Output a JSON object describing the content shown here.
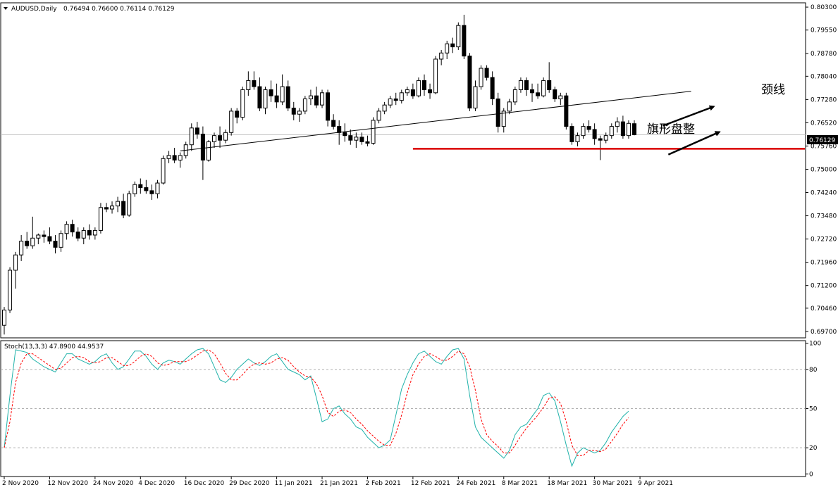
{
  "symbol_header": "AUDUSD,Daily",
  "ohlc_header": "0.76494 0.76600 0.76114 0.76129",
  "stoch_header": "Stoch(13,3,3) 47.8900 44.9537",
  "annotations": {
    "neckline_label": "颈线",
    "flag_label": "旗形盘整"
  },
  "colors": {
    "candle_outline": "#000000",
    "up_fill": "#ffffff",
    "down_fill": "#000000",
    "support_line": "#d90000",
    "stoch_main": "#20b2aa",
    "stoch_signal": "#ff0000",
    "price_marker_bg": "#000000"
  },
  "chart_data": [
    {
      "type": "candlestick",
      "title": "AUDUSD,Daily",
      "ylim": [
        0.6949,
        0.8044
      ],
      "price_ticks": [
        "0.80300",
        "0.79550",
        "0.78780",
        "0.78040",
        "0.77280",
        "0.76520",
        "0.75760",
        "0.75000",
        "0.74240",
        "0.73480",
        "0.72720",
        "0.71960",
        "0.71200",
        "0.70460",
        "0.69700"
      ],
      "current_price": "0.76129",
      "x_labels": [
        "2 Nov 2020",
        "12 Nov 2020",
        "24 Nov 2020",
        "4 Dec 2020",
        "16 Dec 2020",
        "29 Dec 2020",
        "11 Jan 2021",
        "21 Jan 2021",
        "2 Feb 2021",
        "12 Feb 2021",
        "24 Feb 2021",
        "8 Mar 2021",
        "18 Mar 2021",
        "30 Mar 2021",
        "9 Apr 2021"
      ],
      "support_level": 0.7567,
      "neckline": {
        "start": [
          31,
          0.756
        ],
        "end": [
          121,
          0.7755
        ]
      },
      "flag_arrows": [
        {
          "start": [
            116,
            0.7642
          ],
          "end": [
            125,
            0.7705
          ]
        },
        {
          "start": [
            117,
            0.7548
          ],
          "end": [
            126,
            0.7622
          ]
        }
      ],
      "ohlc": [
        [
          0.699,
          0.705,
          0.696,
          0.704
        ],
        [
          0.704,
          0.718,
          0.703,
          0.717
        ],
        [
          0.717,
          0.723,
          0.711,
          0.722
        ],
        [
          0.722,
          0.7285,
          0.72,
          0.7265
        ],
        [
          0.7265,
          0.7295,
          0.724,
          0.725
        ],
        [
          0.725,
          0.7345,
          0.724,
          0.7275
        ],
        [
          0.7275,
          0.729,
          0.7255,
          0.7285
        ],
        [
          0.7285,
          0.73,
          0.726,
          0.728
        ],
        [
          0.728,
          0.731,
          0.7255,
          0.7265
        ],
        [
          0.7265,
          0.7285,
          0.7225,
          0.7245
        ],
        [
          0.7245,
          0.73,
          0.723,
          0.729
        ],
        [
          0.729,
          0.733,
          0.727,
          0.732
        ],
        [
          0.732,
          0.7335,
          0.728,
          0.7295
        ],
        [
          0.7295,
          0.731,
          0.7265,
          0.7275
        ],
        [
          0.7275,
          0.731,
          0.7255,
          0.73
        ],
        [
          0.73,
          0.732,
          0.727,
          0.7285
        ],
        [
          0.7285,
          0.731,
          0.727,
          0.73
        ],
        [
          0.73,
          0.739,
          0.729,
          0.7375
        ],
        [
          0.7375,
          0.739,
          0.736,
          0.737
        ],
        [
          0.737,
          0.7395,
          0.7355,
          0.738
        ],
        [
          0.738,
          0.741,
          0.736,
          0.7395
        ],
        [
          0.7395,
          0.742,
          0.734,
          0.735
        ],
        [
          0.735,
          0.743,
          0.7345,
          0.742
        ],
        [
          0.742,
          0.746,
          0.741,
          0.745
        ],
        [
          0.745,
          0.747,
          0.742,
          0.744
        ],
        [
          0.744,
          0.7465,
          0.742,
          0.743
        ],
        [
          0.743,
          0.745,
          0.74,
          0.742
        ],
        [
          0.742,
          0.7465,
          0.7405,
          0.7455
        ],
        [
          0.7455,
          0.7545,
          0.745,
          0.7535
        ],
        [
          0.7535,
          0.756,
          0.752,
          0.7545
        ],
        [
          0.7545,
          0.757,
          0.752,
          0.753
        ],
        [
          0.753,
          0.7555,
          0.7505,
          0.7545
        ],
        [
          0.7545,
          0.759,
          0.7535,
          0.758
        ],
        [
          0.758,
          0.765,
          0.756,
          0.7635
        ],
        [
          0.7635,
          0.7655,
          0.76,
          0.7615
        ],
        [
          0.7615,
          0.764,
          0.7465,
          0.753
        ],
        [
          0.753,
          0.7595,
          0.7525,
          0.759
        ],
        [
          0.759,
          0.762,
          0.757,
          0.761
        ],
        [
          0.761,
          0.764,
          0.757,
          0.7595
        ],
        [
          0.7595,
          0.763,
          0.7585,
          0.762
        ],
        [
          0.762,
          0.77,
          0.761,
          0.769
        ],
        [
          0.769,
          0.77,
          0.765,
          0.767
        ],
        [
          0.767,
          0.777,
          0.766,
          0.776
        ],
        [
          0.776,
          0.782,
          0.774,
          0.779
        ],
        [
          0.779,
          0.782,
          0.776,
          0.777
        ],
        [
          0.777,
          0.78,
          0.769,
          0.77
        ],
        [
          0.77,
          0.777,
          0.768,
          0.776
        ],
        [
          0.776,
          0.779,
          0.772,
          0.774
        ],
        [
          0.774,
          0.778,
          0.77,
          0.772
        ],
        [
          0.772,
          0.781,
          0.771,
          0.777
        ],
        [
          0.777,
          0.779,
          0.769,
          0.77
        ],
        [
          0.77,
          0.772,
          0.766,
          0.768
        ],
        [
          0.768,
          0.77,
          0.7655,
          0.769
        ],
        [
          0.769,
          0.774,
          0.768,
          0.773
        ],
        [
          0.773,
          0.776,
          0.771,
          0.774
        ],
        [
          0.774,
          0.777,
          0.77,
          0.771
        ],
        [
          0.771,
          0.776,
          0.77,
          0.775
        ],
        [
          0.775,
          0.776,
          0.764,
          0.766
        ],
        [
          0.766,
          0.768,
          0.763,
          0.764
        ],
        [
          0.764,
          0.766,
          0.758,
          0.762
        ],
        [
          0.762,
          0.765,
          0.759,
          0.761
        ],
        [
          0.761,
          0.763,
          0.758,
          0.7595
        ],
        [
          0.7595,
          0.762,
          0.757,
          0.7605
        ],
        [
          0.7605,
          0.762,
          0.758,
          0.759
        ],
        [
          0.759,
          0.761,
          0.7575,
          0.7585
        ],
        [
          0.7585,
          0.767,
          0.758,
          0.766
        ],
        [
          0.766,
          0.77,
          0.765,
          0.769
        ],
        [
          0.769,
          0.772,
          0.768,
          0.771
        ],
        [
          0.771,
          0.774,
          0.77,
          0.773
        ],
        [
          0.773,
          0.775,
          0.771,
          0.7725
        ],
        [
          0.7725,
          0.776,
          0.7715,
          0.775
        ],
        [
          0.775,
          0.777,
          0.774,
          0.776
        ],
        [
          0.776,
          0.778,
          0.773,
          0.774
        ],
        [
          0.774,
          0.78,
          0.7735,
          0.779
        ],
        [
          0.779,
          0.781,
          0.774,
          0.776
        ],
        [
          0.776,
          0.778,
          0.773,
          0.775
        ],
        [
          0.775,
          0.787,
          0.7745,
          0.786
        ],
        [
          0.786,
          0.789,
          0.784,
          0.788
        ],
        [
          0.788,
          0.792,
          0.786,
          0.791
        ],
        [
          0.791,
          0.793,
          0.788,
          0.79
        ],
        [
          0.79,
          0.798,
          0.789,
          0.797
        ],
        [
          0.797,
          0.8005,
          0.786,
          0.787
        ],
        [
          0.787,
          0.788,
          0.769,
          0.77
        ],
        [
          0.77,
          0.779,
          0.769,
          0.777
        ],
        [
          0.777,
          0.784,
          0.776,
          0.783
        ],
        [
          0.783,
          0.784,
          0.779,
          0.78
        ],
        [
          0.78,
          0.782,
          0.771,
          0.773
        ],
        [
          0.773,
          0.775,
          0.762,
          0.764
        ],
        [
          0.764,
          0.77,
          0.762,
          0.769
        ],
        [
          0.769,
          0.773,
          0.768,
          0.772
        ],
        [
          0.772,
          0.777,
          0.771,
          0.776
        ],
        [
          0.776,
          0.78,
          0.775,
          0.779
        ],
        [
          0.779,
          0.78,
          0.774,
          0.776
        ],
        [
          0.776,
          0.778,
          0.772,
          0.775
        ],
        [
          0.775,
          0.778,
          0.773,
          0.774
        ],
        [
          0.774,
          0.78,
          0.7735,
          0.779
        ],
        [
          0.779,
          0.785,
          0.775,
          0.776
        ],
        [
          0.776,
          0.777,
          0.772,
          0.773
        ],
        [
          0.773,
          0.775,
          0.771,
          0.774
        ],
        [
          0.774,
          0.775,
          0.763,
          0.764
        ],
        [
          0.764,
          0.765,
          0.758,
          0.759
        ],
        [
          0.759,
          0.762,
          0.7575,
          0.761
        ],
        [
          0.761,
          0.765,
          0.76,
          0.764
        ],
        [
          0.764,
          0.766,
          0.762,
          0.763
        ],
        [
          0.763,
          0.765,
          0.758,
          0.76
        ],
        [
          0.76,
          0.761,
          0.753,
          0.7595
        ],
        [
          0.7595,
          0.762,
          0.7585,
          0.761
        ],
        [
          0.761,
          0.765,
          0.76,
          0.764
        ],
        [
          0.764,
          0.767,
          0.762,
          0.7655
        ],
        [
          0.7655,
          0.7675,
          0.76,
          0.761
        ],
        [
          0.761,
          0.766,
          0.76,
          0.765
        ],
        [
          0.7649,
          0.766,
          0.7611,
          0.7613
        ]
      ]
    },
    {
      "type": "line",
      "title": "Stoch(13,3,3)",
      "ylim": [
        -2,
        102
      ],
      "y_ticks": [
        "100",
        "80",
        "50",
        "20",
        "0"
      ],
      "levels": [
        20,
        50,
        80
      ],
      "series": [
        {
          "values": [
            20,
            60,
            95,
            94,
            93,
            88,
            85,
            82,
            80,
            78,
            85,
            92,
            92,
            88,
            86,
            84,
            86,
            90,
            92,
            85,
            80,
            82,
            88,
            94,
            94,
            90,
            84,
            80,
            85,
            87,
            86,
            84,
            88,
            92,
            95,
            96,
            92,
            82,
            72,
            70,
            74,
            80,
            84,
            88,
            85,
            83,
            86,
            90,
            92,
            86,
            80,
            78,
            76,
            72,
            75,
            58,
            40,
            42,
            50,
            52,
            46,
            42,
            36,
            34,
            28,
            24,
            20,
            22,
            26,
            45,
            65,
            76,
            85,
            92,
            94,
            90,
            86,
            84,
            90,
            95,
            96,
            88,
            60,
            36,
            28,
            24,
            20,
            16,
            12,
            18,
            30,
            36,
            38,
            44,
            50,
            60,
            62,
            56,
            40,
            22,
            6,
            16,
            20,
            18,
            16,
            18,
            24,
            32,
            38,
            44,
            48
          ]
        },
        {
          "values": [
            20,
            40,
            70,
            85,
            92,
            92,
            89,
            86,
            83,
            80,
            81,
            85,
            89,
            90,
            89,
            86,
            85,
            86,
            89,
            89,
            86,
            83,
            83,
            86,
            90,
            92,
            90,
            85,
            83,
            84,
            86,
            86,
            86,
            88,
            91,
            94,
            95,
            92,
            85,
            77,
            72,
            72,
            76,
            81,
            84,
            85,
            84,
            85,
            88,
            89,
            87,
            82,
            78,
            75,
            74,
            69,
            60,
            47,
            44,
            48,
            49,
            47,
            42,
            38,
            33,
            29,
            25,
            22,
            22,
            31,
            45,
            62,
            76,
            84,
            90,
            92,
            90,
            87,
            87,
            90,
            94,
            92,
            82,
            64,
            42,
            30,
            25,
            21,
            16,
            16,
            22,
            29,
            35,
            40,
            45,
            51,
            58,
            59,
            54,
            40,
            22,
            14,
            14,
            18,
            18,
            17,
            19,
            25,
            31,
            38,
            43
          ]
        }
      ]
    }
  ]
}
